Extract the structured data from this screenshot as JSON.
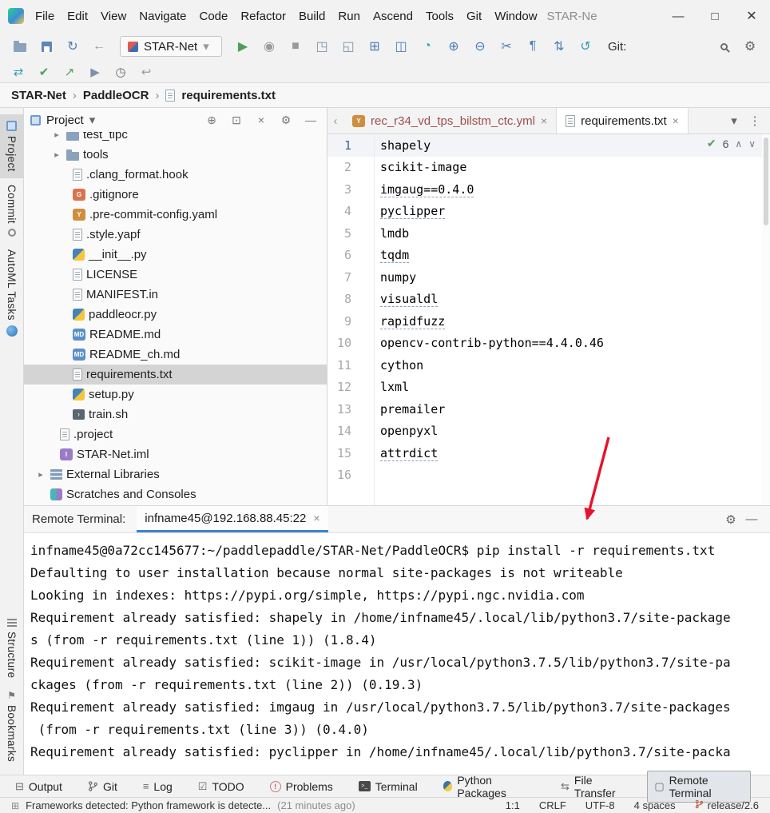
{
  "colors": {
    "accent": "#4083c9",
    "run_green": "#4f9e58",
    "selection": "#d4d4d4",
    "annotation_arrow": "#e8112d",
    "modified_tab_text": "#9c4f4f"
  },
  "window": {
    "title": "STAR-Ne",
    "menu_items": [
      "File",
      "Edit",
      "View",
      "Navigate",
      "Code",
      "Refactor",
      "Build",
      "Run",
      "Ascend",
      "Tools",
      "Git",
      "Window"
    ],
    "controls": {
      "minimize": "—",
      "maximize": "□",
      "close": "✕"
    }
  },
  "toolbar": {
    "run_config": "STAR-Net",
    "git_label": "Git:"
  },
  "breadcrumbs": {
    "items": [
      "STAR-Net",
      "PaddleOCR",
      "requirements.txt"
    ]
  },
  "stripe": {
    "top": [
      "Project",
      "Commit",
      "AutoML Tasks"
    ],
    "bottom": [
      "Structure",
      "Bookmarks"
    ]
  },
  "project": {
    "title": "Project",
    "rows": [
      "test_tipc",
      "tools",
      ".clang_format.hook",
      ".gitignore",
      ".pre-commit-config.yaml",
      ".style.yapf",
      "__init__.py",
      "LICENSE",
      "MANIFEST.in",
      "paddleocr.py",
      "README.md",
      "README_ch.md",
      "requirements.txt",
      "setup.py",
      "train.sh",
      ".project",
      "STAR-Net.iml",
      "External Libraries",
      "Scratches and Consoles"
    ]
  },
  "editor": {
    "tabs": [
      "rec_r34_vd_tps_bilstm_ctc.yml",
      "requirements.txt"
    ],
    "inspections": {
      "count": "6"
    },
    "lines": [
      {
        "n": "1",
        "t": "shapely"
      },
      {
        "n": "2",
        "t": "scikit-image"
      },
      {
        "n": "3",
        "t": "imgaug==0.4.0"
      },
      {
        "n": "4",
        "t": "pyclipper"
      },
      {
        "n": "5",
        "t": "lmdb"
      },
      {
        "n": "6",
        "t": "tqdm"
      },
      {
        "n": "7",
        "t": "numpy"
      },
      {
        "n": "8",
        "t": "visualdl"
      },
      {
        "n": "9",
        "t": "rapidfuzz"
      },
      {
        "n": "10",
        "t": "opencv-contrib-python==4.4.0.46"
      },
      {
        "n": "11",
        "t": "cython"
      },
      {
        "n": "12",
        "t": "lxml"
      },
      {
        "n": "13",
        "t": "premailer"
      },
      {
        "n": "14",
        "t": "openpyxl"
      },
      {
        "n": "15",
        "t": "attrdict"
      },
      {
        "n": "16",
        "t": ""
      }
    ]
  },
  "terminal": {
    "label": "Remote Terminal:",
    "tab": "infname45@192.168.88.45:22",
    "lines": [
      "infname45@0a72cc145677:~/paddlepaddle/STAR-Net/PaddleOCR$ pip install -r requirements.txt",
      "Defaulting to user installation because normal site-packages is not writeable",
      "Looking in indexes: https://pypi.org/simple, https://pypi.ngc.nvidia.com",
      "Requirement already satisfied: shapely in /home/infname45/.local/lib/python3.7/site-package",
      "s (from -r requirements.txt (line 1)) (1.8.4)",
      "Requirement already satisfied: scikit-image in /usr/local/python3.7.5/lib/python3.7/site-pa",
      "ckages (from -r requirements.txt (line 2)) (0.19.3)",
      "Requirement already satisfied: imgaug in /usr/local/python3.7.5/lib/python3.7/site-packages",
      " (from -r requirements.txt (line 3)) (0.4.0)",
      "Requirement already satisfied: pyclipper in /home/infname45/.local/lib/python3.7/site-packa"
    ]
  },
  "toolwindows": [
    "Output",
    "Git",
    "Log",
    "TODO",
    "Problems",
    "Terminal",
    "Python Packages",
    "File Transfer",
    "Remote Terminal"
  ],
  "statusbar": {
    "message": "Frameworks detected: Python framework is detecte...",
    "time": "(21 minutes ago)",
    "caret": "1:1",
    "line_ending": "CRLF",
    "encoding": "UTF-8",
    "indent": "4 spaces",
    "branch": "release/2.6"
  },
  "icons": {
    "crumb_sep": "›",
    "scroll_left": "‹",
    "chevron_right": "▸",
    "chevron_down": "▾",
    "close": "×",
    "minimize": "—",
    "maximize": "□",
    "sync": "↻",
    "back": "←",
    "run": "▶",
    "profiler": "◉",
    "stop": "■",
    "download": "◳",
    "upload": "◱",
    "remote_run": "⊞",
    "monitor": "◫",
    "coverage": "◔",
    "zoom_in": "⊕",
    "zoom_out": "⊖",
    "cut": "✂",
    "pilcrow": "¶",
    "sort": "⇅",
    "update": "↺",
    "connect": "⇄",
    "check": "✔",
    "push": "↗",
    "resume": "▶",
    "history": "◷",
    "undo": "↩",
    "locate": "⊕",
    "expand_all": "⊡",
    "gear": "⚙",
    "more": "⋮",
    "up": "∧",
    "down": "∨",
    "output": "⊟",
    "log": "≡",
    "todo": "☑",
    "warning": "!",
    "terminal_prompt": ">_",
    "transfer": "⇆",
    "remote_monitor": "▢",
    "bookmark": "⚑",
    "win": "⊞",
    "shell_arrow": "›",
    "badge_y": "Y",
    "badge_md": "MD",
    "badge_g": "G",
    "badge_i": "I"
  }
}
